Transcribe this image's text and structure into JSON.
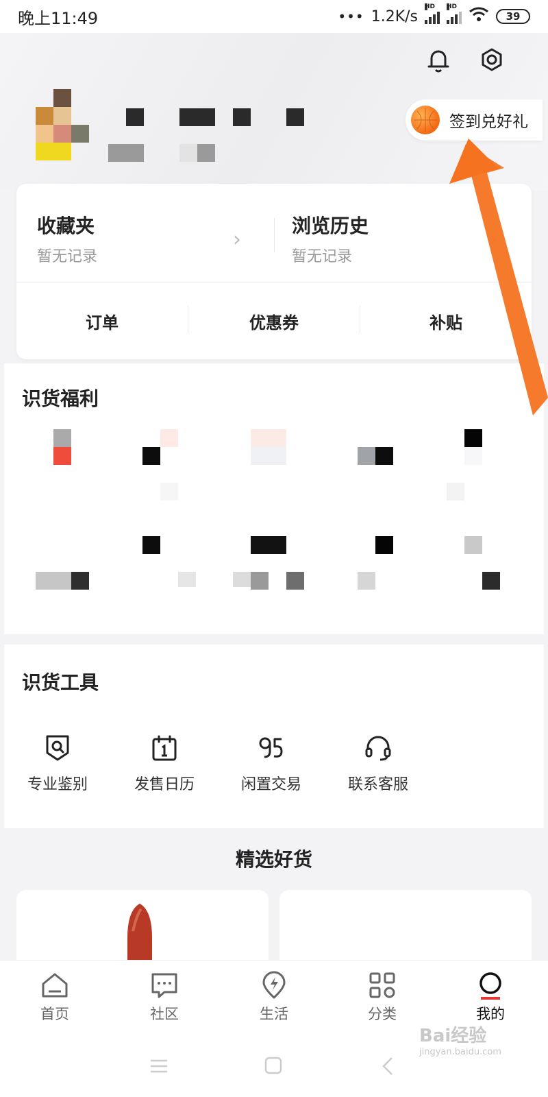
{
  "status_bar": {
    "time": "晚上11:49",
    "network_speed": "1.2K/s",
    "hd_label": "HD",
    "battery": "39"
  },
  "header": {
    "notification_icon": "bell-icon",
    "settings_icon": "gear-icon"
  },
  "checkin": {
    "label": "签到兑好礼",
    "icon": "basketball-icon"
  },
  "favorites": {
    "title": "收藏夹",
    "subtitle": "暂无记录"
  },
  "history": {
    "title": "浏览历史",
    "subtitle": "暂无记录"
  },
  "quick_tabs": [
    {
      "label": "订单"
    },
    {
      "label": "优惠券"
    },
    {
      "label": "补贴"
    }
  ],
  "benefits": {
    "title": "识货福利"
  },
  "tools": {
    "title": "识货工具",
    "items": [
      {
        "label": "专业鉴别",
        "icon": "search-shield-icon"
      },
      {
        "label": "发售日历",
        "icon": "calendar-icon"
      },
      {
        "label": "闲置交易",
        "icon": "idle-95-icon"
      },
      {
        "label": "联系客服",
        "icon": "headset-icon"
      }
    ]
  },
  "featured": {
    "title": "精选好货"
  },
  "bottom_nav": [
    {
      "label": "首页",
      "icon": "home-icon"
    },
    {
      "label": "社区",
      "icon": "chat-icon"
    },
    {
      "label": "生活",
      "icon": "location-bolt-icon"
    },
    {
      "label": "分类",
      "icon": "grid-icon"
    },
    {
      "label": "我的",
      "icon": "profile-circle-icon"
    }
  ],
  "watermark": {
    "text": "Bai经验",
    "sub": "jingyan.baidu.com"
  },
  "colors": {
    "accent": "#f57320",
    "active_underline": "#e53935"
  }
}
